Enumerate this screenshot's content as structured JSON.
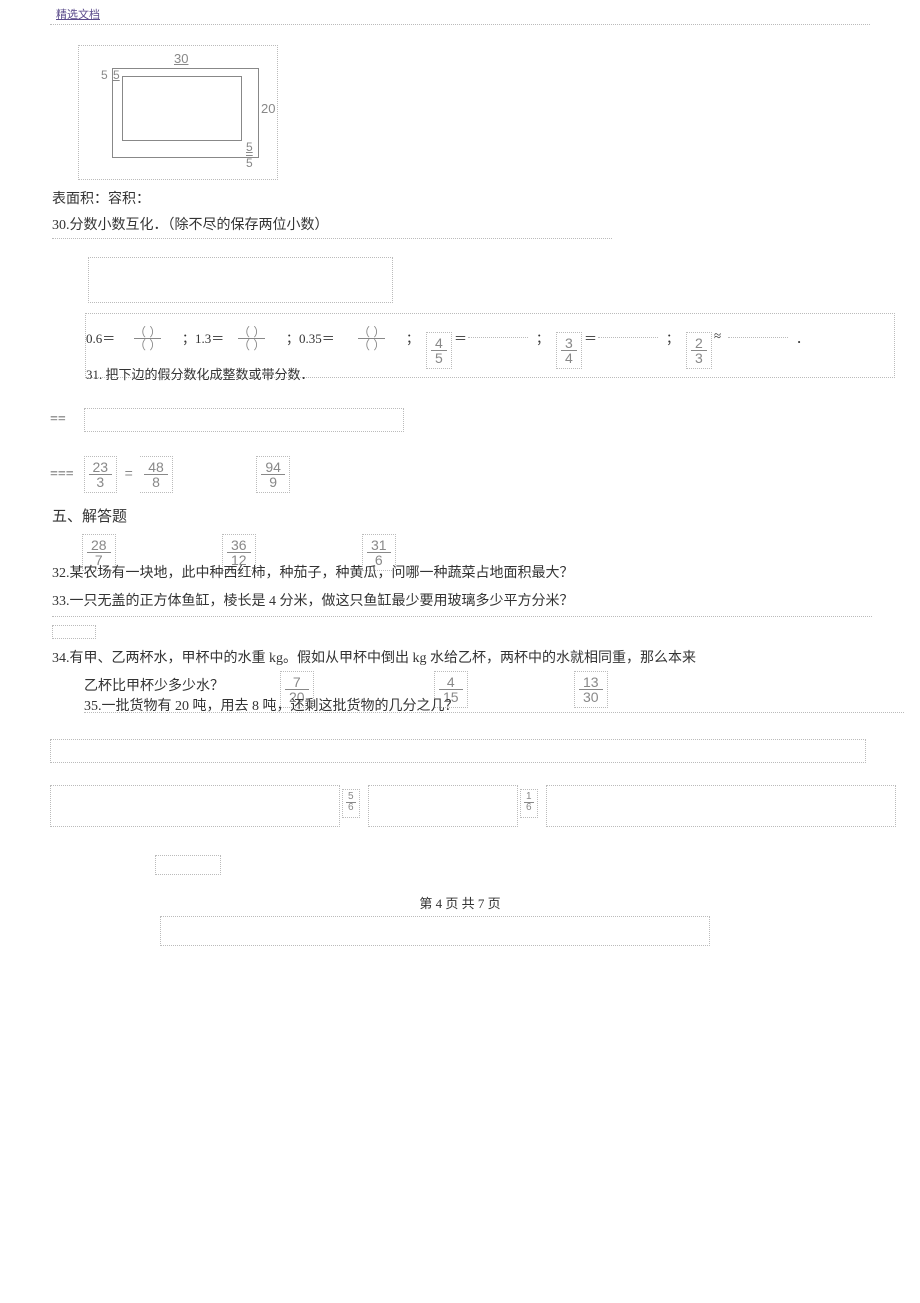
{
  "header": "精选文档",
  "diagram": {
    "top": "30",
    "left1": "5",
    "left2": "5",
    "right": "20",
    "bot1": "5",
    "bot2": "5"
  },
  "q29_label": "表面积：容积：",
  "q30": {
    "text": "30.分数小数互化．（除不尽的保存两位小数）"
  },
  "q30row": {
    "a": "0.6＝",
    "b": "；1.3＝",
    "c": "；0.35＝",
    "d": "；",
    "e": "＝",
    "f": "；",
    "g": "＝",
    "h": "；",
    "i": "≈",
    "j": "．",
    "f1n": "4",
    "f1d": "5",
    "f2n": "3",
    "f2d": "4",
    "f3n": "2",
    "f3d": "3",
    "blankN": "（  ）",
    "blankD": "（  ）"
  },
  "q31": "31.     把下边的假分数化成整数或带分数．",
  "eqA": "==",
  "eqB": "===",
  "fr23_3n": "23",
  "fr23_3d": "3",
  "eq48": "=",
  "fr48_8n": "48",
  "fr48_8d": "8",
  "fr94_9n": "94",
  "fr94_9d": "9",
  "sec5": "五、解答题",
  "fr28_7n": "28",
  "fr28_7d": "7",
  "fr36_12n": "36",
  "fr36_12d": "12",
  "fr31_6n": "31",
  "fr31_6d": "6",
  "q32": "32.某农场有一块地，此中种西红柿，种茄子，种黄瓜，问哪一种蔬菜占地面积最大？",
  "q33": "33.一只无盖的正方体鱼缸，棱长是 4 分米，做这只鱼缸最少要用玻璃多少平方分米？",
  "q34a": "34.有甲、乙两杯水，甲杯中的水重 kg。假如从甲杯中倒出 kg 水给乙杯，两杯中的水就相同重，那么本来",
  "q34b_line1": "乙杯比甲杯少多少水？",
  "q35": "35.一批货物有 20 吨，用去 8 吨，还剩这批货物的几分之几？",
  "fr7_20n": "7",
  "fr7_20d": "20",
  "fr4_15n": "4",
  "fr4_15d": "15",
  "fr13_30n": "13",
  "fr13_30d": "30",
  "sf1n": "5",
  "sf1d": "6",
  "sf2n": "1",
  "sf2d": "6",
  "pager": "第 4 页 共 7 页"
}
